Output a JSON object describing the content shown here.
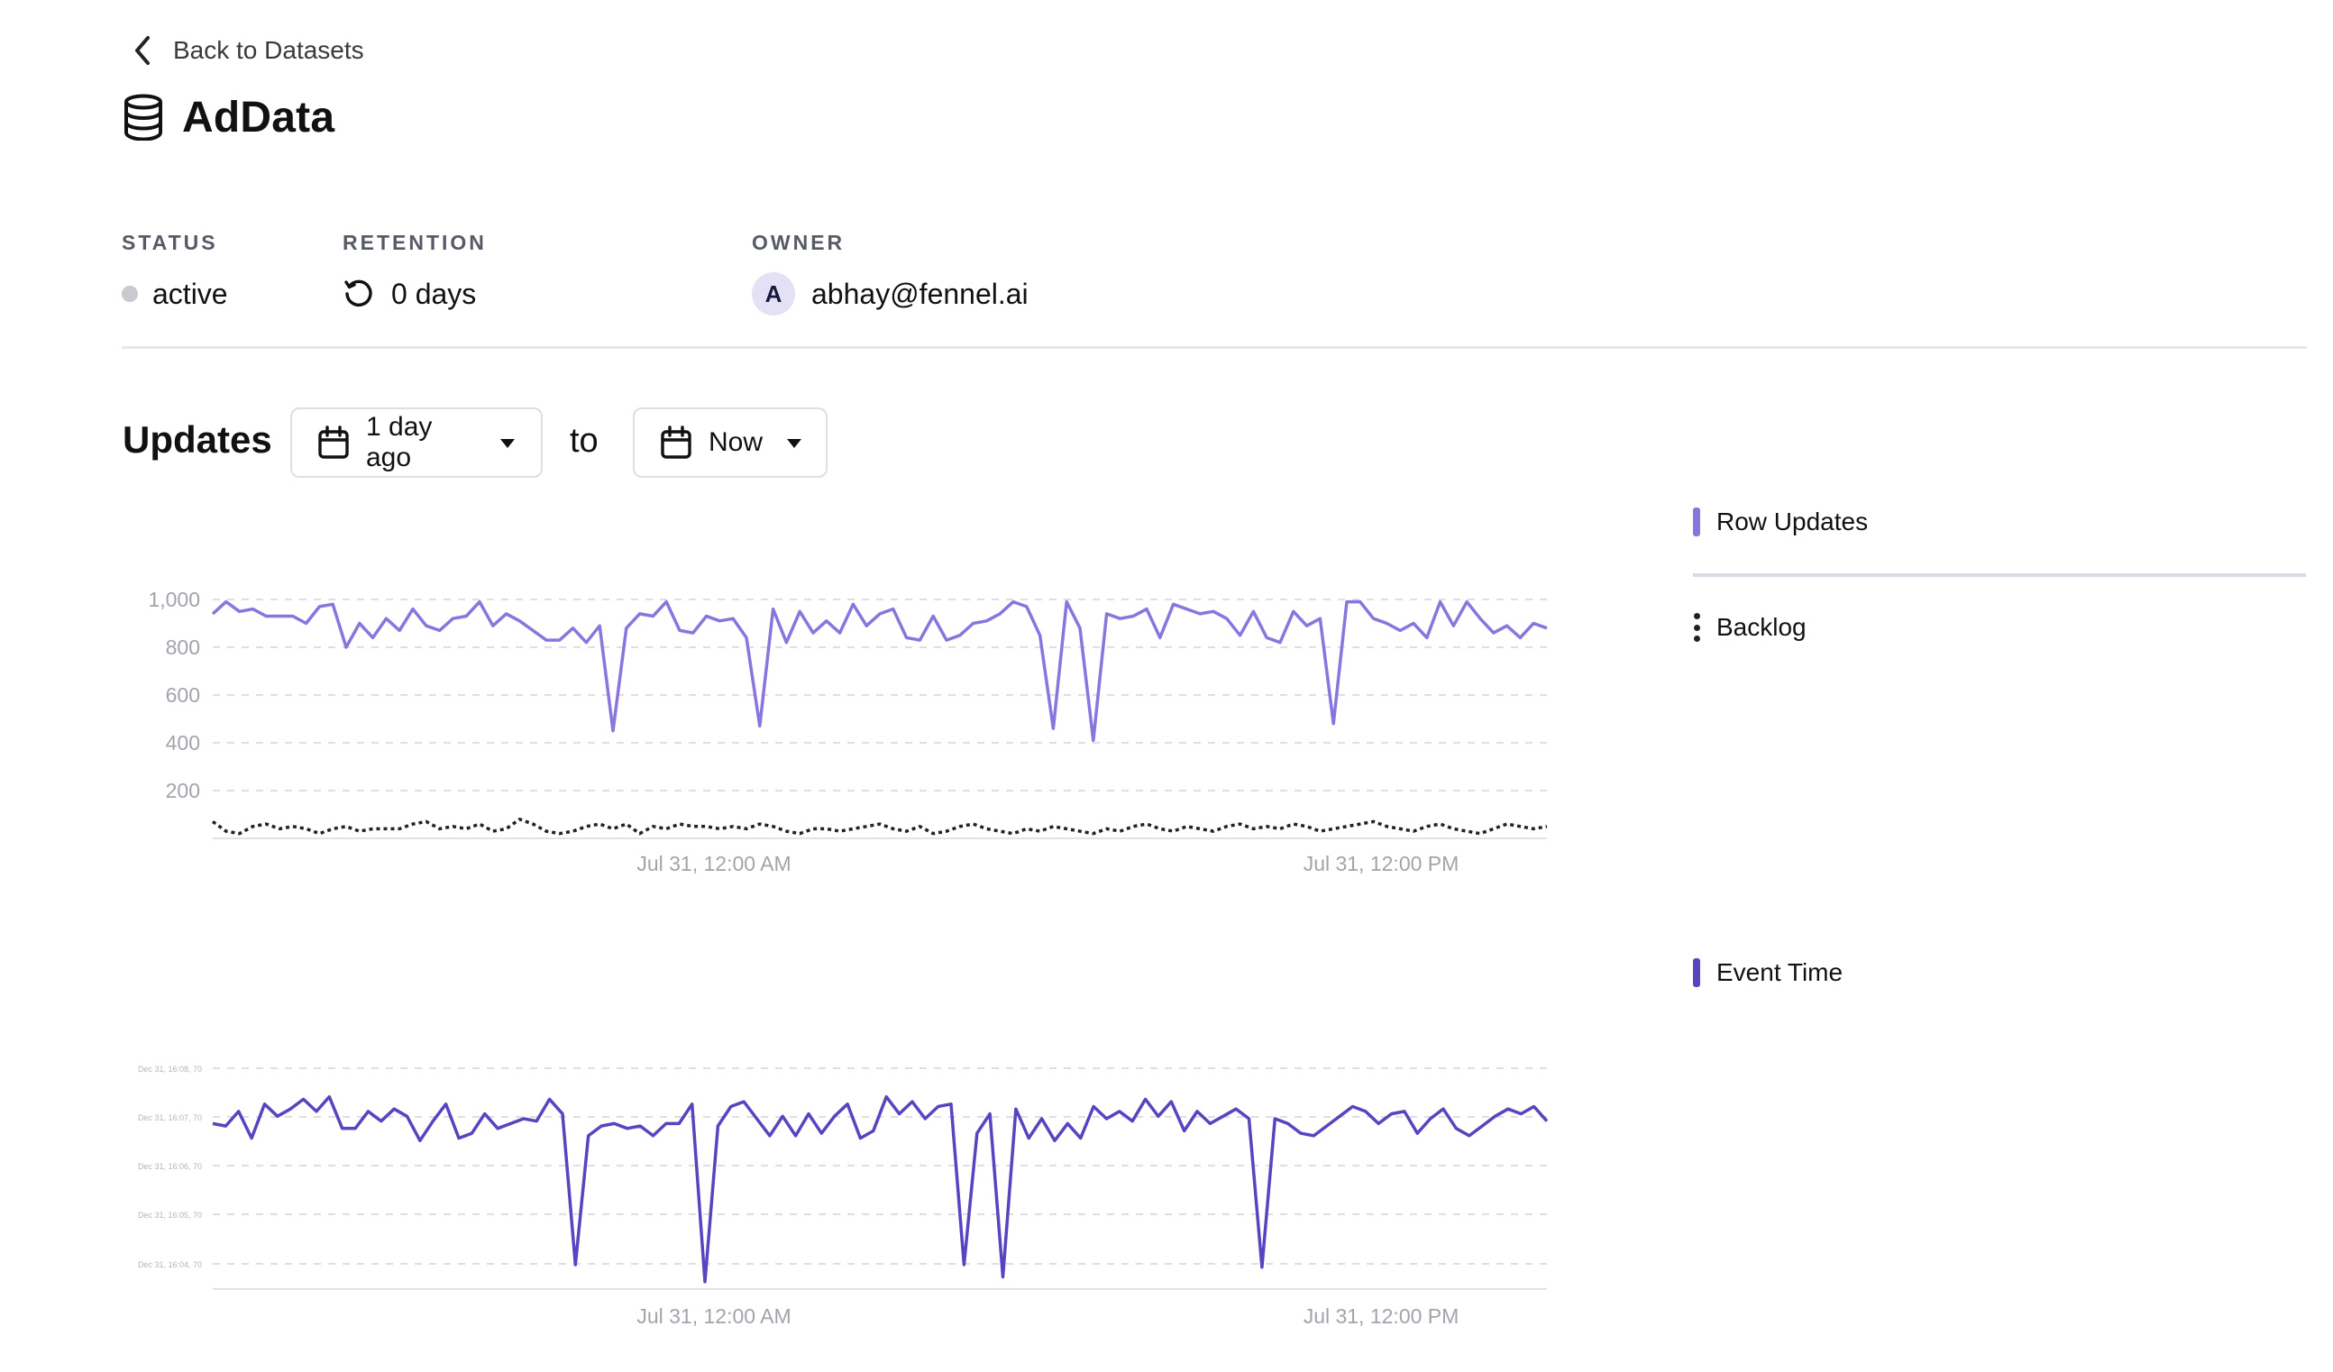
{
  "nav": {
    "back_label": "Back to Datasets"
  },
  "dataset": {
    "title": "AdData",
    "icon": "database-icon"
  },
  "meta": {
    "status_label": "STATUS",
    "status_value": "active",
    "retention_label": "RETENTION",
    "retention_value": "0 days",
    "owner_label": "OWNER",
    "owner_initial": "A",
    "owner_value": "abhay@fennel.ai"
  },
  "updates": {
    "title": "Updates",
    "from_label": "1 day ago",
    "to_word": "to",
    "to_label": "Now"
  },
  "legend": {
    "row_updates": "Row Updates",
    "backlog": "Backlog",
    "event_time": "Event Time"
  },
  "colors": {
    "row_updates": "#8a74de",
    "backlog": "#222222",
    "event_time": "#5a43bf",
    "grid": "#dedee6",
    "axis_text": "#a3a3ad"
  },
  "chart_data": [
    {
      "type": "line",
      "y_ticks": [
        "1,000",
        "800",
        "600",
        "400",
        "200"
      ],
      "x_ticks": [
        "Jul 31, 12:00 AM",
        "Jul 31, 12:00 PM"
      ],
      "ylim": [
        0,
        1000
      ],
      "grid": true,
      "series": [
        {
          "name": "Row Updates",
          "values": [
            940,
            990,
            950,
            960,
            930,
            930,
            930,
            900,
            970,
            980,
            800,
            900,
            840,
            920,
            870,
            960,
            890,
            870,
            920,
            930,
            990,
            890,
            940,
            910,
            870,
            830,
            830,
            880,
            820,
            890,
            450,
            880,
            940,
            930,
            990,
            870,
            860,
            930,
            910,
            920,
            840,
            470,
            960,
            820,
            950,
            860,
            910,
            860,
            980,
            890,
            940,
            960,
            840,
            830,
            930,
            830,
            850,
            900,
            910,
            940,
            990,
            970,
            850,
            460,
            990,
            880,
            410,
            940,
            920,
            930,
            960,
            840,
            980,
            960,
            940,
            950,
            920,
            850,
            950,
            840,
            820,
            950,
            890,
            920,
            480,
            990,
            990,
            920,
            900,
            870,
            900,
            840,
            990,
            890,
            990,
            920,
            860,
            890,
            840,
            900,
            880
          ]
        },
        {
          "name": "Backlog",
          "values": [
            70,
            30,
            20,
            50,
            60,
            40,
            50,
            40,
            20,
            40,
            50,
            30,
            40,
            40,
            40,
            60,
            70,
            40,
            50,
            40,
            60,
            30,
            40,
            80,
            60,
            30,
            20,
            30,
            50,
            60,
            40,
            60,
            20,
            50,
            40,
            60,
            50,
            50,
            40,
            50,
            40,
            60,
            50,
            30,
            20,
            40,
            40,
            30,
            40,
            50,
            60,
            40,
            30,
            50,
            20,
            30,
            50,
            60,
            40,
            30,
            20,
            40,
            30,
            50,
            40,
            30,
            20,
            40,
            30,
            50,
            60,
            40,
            30,
            50,
            40,
            30,
            50,
            60,
            40,
            50,
            40,
            60,
            50,
            30,
            40,
            50,
            60,
            70,
            50,
            40,
            30,
            50,
            60,
            40,
            30,
            20,
            40,
            60,
            50,
            40,
            50
          ]
        }
      ]
    },
    {
      "type": "line",
      "y_ticks": [
        "Dec 31, 16:08, 70",
        "Dec 31, 16:07, 70",
        "Dec 31, 16:06, 70",
        "Dec 31, 16:05, 70",
        "Dec 31, 16:04, 70"
      ],
      "x_ticks": [
        "Jul 31, 12:00 AM",
        "Jul 31, 12:00 PM"
      ],
      "grid": true,
      "series": [
        {
          "name": "Event Time",
          "values": [
            0.68,
            0.67,
            0.73,
            0.62,
            0.76,
            0.71,
            0.74,
            0.78,
            0.73,
            0.79,
            0.66,
            0.66,
            0.73,
            0.69,
            0.74,
            0.71,
            0.61,
            0.69,
            0.76,
            0.62,
            0.64,
            0.72,
            0.66,
            0.68,
            0.7,
            0.69,
            0.78,
            0.72,
            0.1,
            0.63,
            0.67,
            0.68,
            0.66,
            0.67,
            0.63,
            0.68,
            0.68,
            0.76,
            0.03,
            0.67,
            0.75,
            0.77,
            0.7,
            0.63,
            0.71,
            0.63,
            0.72,
            0.64,
            0.71,
            0.76,
            0.62,
            0.65,
            0.79,
            0.72,
            0.77,
            0.7,
            0.75,
            0.76,
            0.1,
            0.64,
            0.72,
            0.05,
            0.74,
            0.62,
            0.7,
            0.61,
            0.68,
            0.62,
            0.75,
            0.7,
            0.73,
            0.69,
            0.78,
            0.71,
            0.77,
            0.65,
            0.73,
            0.68,
            0.71,
            0.74,
            0.7,
            0.09,
            0.7,
            0.68,
            0.64,
            0.63,
            0.67,
            0.71,
            0.75,
            0.73,
            0.68,
            0.72,
            0.73,
            0.64,
            0.7,
            0.74,
            0.66,
            0.63,
            0.67,
            0.71,
            0.74,
            0.72,
            0.75,
            0.69
          ]
        }
      ]
    }
  ]
}
